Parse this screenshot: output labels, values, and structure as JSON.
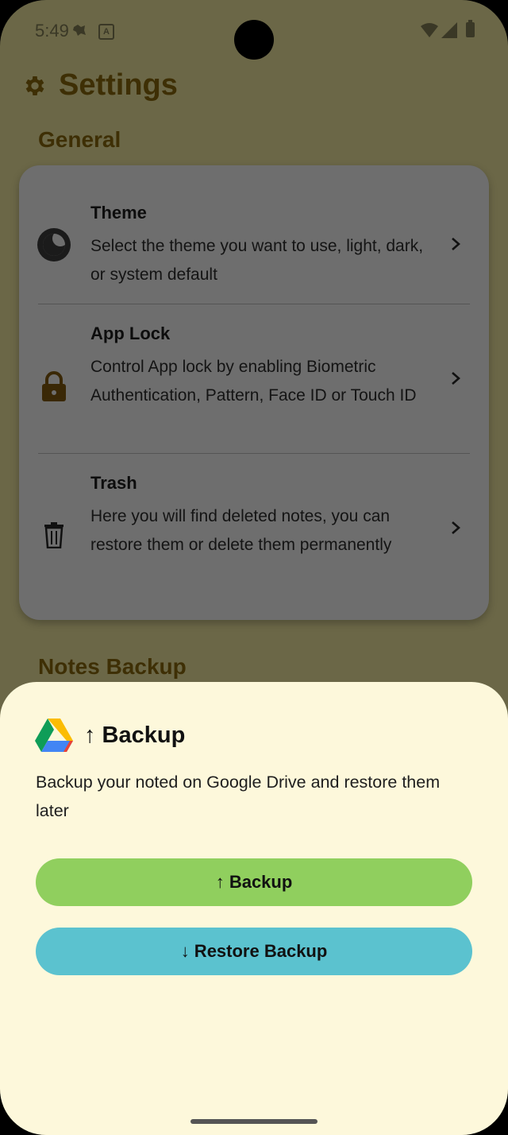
{
  "status_bar": {
    "time": "5:49",
    "a_badge": "A"
  },
  "header": {
    "title": "Settings"
  },
  "sections": {
    "general": "General",
    "notes_backup": "Notes Backup"
  },
  "settings": [
    {
      "title": "Theme",
      "description": "Select the theme you want to use, light, dark, or system default",
      "icon": "theme-icon"
    },
    {
      "title": "App Lock",
      "description": "Control App lock by enabling Biometric Authentication, Pattern, Face ID or Touch ID",
      "icon": "lock-icon"
    },
    {
      "title": "Trash",
      "description": "Here you will find deleted notes, you can restore them or delete them permanently",
      "icon": "trash-icon"
    }
  ],
  "sheet": {
    "title": "↑ Backup",
    "description": "Backup your noted on Google Drive and restore them later",
    "backup_button": "↑ Backup",
    "restore_button": "↓ Restore Backup"
  },
  "colors": {
    "backup": "#90cf5e",
    "restore": "#5bc2cf",
    "sheet": "#fdf8db"
  }
}
